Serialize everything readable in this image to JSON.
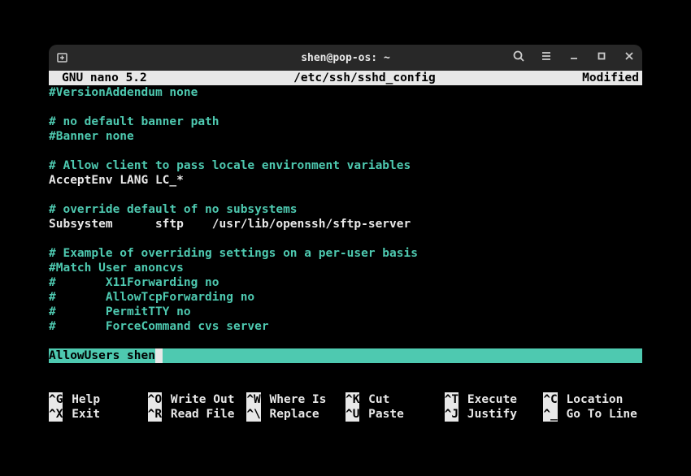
{
  "titlebar": {
    "title": "shen@pop-os: ~"
  },
  "header": {
    "app": "GNU nano 5.2",
    "file": "/etc/ssh/sshd_config",
    "status": "Modified"
  },
  "lines": [
    {
      "type": "comment",
      "text": "#VersionAddendum none"
    },
    {
      "type": "empty",
      "text": ""
    },
    {
      "type": "comment",
      "text": "# no default banner path"
    },
    {
      "type": "comment",
      "text": "#Banner none"
    },
    {
      "type": "empty",
      "text": ""
    },
    {
      "type": "comment",
      "text": "# Allow client to pass locale environment variables"
    },
    {
      "type": "plain",
      "text": "AcceptEnv LANG LC_*"
    },
    {
      "type": "empty",
      "text": ""
    },
    {
      "type": "comment",
      "text": "# override default of no subsystems"
    },
    {
      "type": "plain",
      "text": "Subsystem      sftp    /usr/lib/openssh/sftp-server"
    },
    {
      "type": "empty",
      "text": ""
    },
    {
      "type": "comment",
      "text": "# Example of overriding settings on a per-user basis"
    },
    {
      "type": "comment",
      "text": "#Match User anoncvs"
    },
    {
      "type": "comment",
      "text": "#       X11Forwarding no"
    },
    {
      "type": "comment",
      "text": "#       AllowTcpForwarding no"
    },
    {
      "type": "comment",
      "text": "#       PermitTTY no"
    },
    {
      "type": "comment",
      "text": "#       ForceCommand cvs server"
    },
    {
      "type": "empty",
      "text": ""
    }
  ],
  "cursor_line": "AllowUsers shen",
  "shortcuts": [
    {
      "key": "^G",
      "label": "Help"
    },
    {
      "key": "^O",
      "label": "Write Out"
    },
    {
      "key": "^W",
      "label": "Where Is"
    },
    {
      "key": "^K",
      "label": "Cut"
    },
    {
      "key": "^T",
      "label": "Execute"
    },
    {
      "key": "^C",
      "label": "Location"
    },
    {
      "key": "^X",
      "label": "Exit"
    },
    {
      "key": "^R",
      "label": "Read File"
    },
    {
      "key": "^\\",
      "label": "Replace"
    },
    {
      "key": "^U",
      "label": "Paste"
    },
    {
      "key": "^J",
      "label": "Justify"
    },
    {
      "key": "^_",
      "label": "Go To Line"
    }
  ]
}
